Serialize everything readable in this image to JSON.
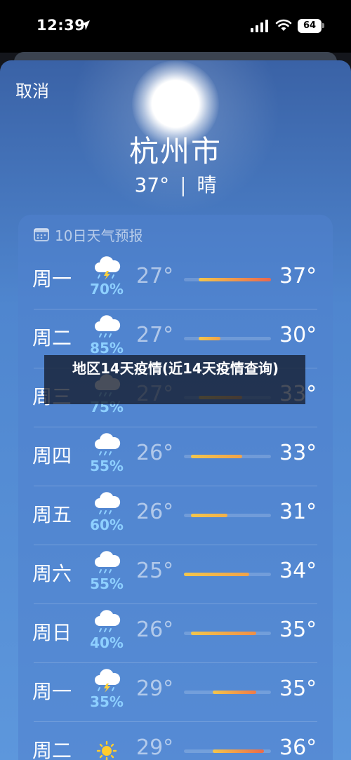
{
  "status_bar": {
    "time": "12:39",
    "battery": "64"
  },
  "header": {
    "cancel_label": "取消",
    "city": "杭州市",
    "current_temp": "37°",
    "current_condition": "晴"
  },
  "forecast": {
    "title": "10日天气预报",
    "temp_range": [
      25,
      37
    ],
    "days": [
      {
        "day": "周一",
        "icon": "thunderstorm-icon",
        "pop": "70%",
        "low": "27°",
        "high": "37°",
        "low_val": 27,
        "high_val": 37,
        "color": "#e9684e"
      },
      {
        "day": "周二",
        "icon": "rain-cloud-icon",
        "pop": "85%",
        "low": "27°",
        "high": "30°",
        "low_val": 27,
        "high_val": 30,
        "color": "#f0a24a"
      },
      {
        "day": "周三",
        "icon": "rain-cloud-icon",
        "pop": "75%",
        "low": "27°",
        "high": "33°",
        "low_val": 27,
        "high_val": 33,
        "color": "#f0a24a"
      },
      {
        "day": "周四",
        "icon": "rain-cloud-icon",
        "pop": "55%",
        "low": "26°",
        "high": "33°",
        "low_val": 26,
        "high_val": 33,
        "color": "#f0a24a"
      },
      {
        "day": "周五",
        "icon": "rain-cloud-icon",
        "pop": "60%",
        "low": "26°",
        "high": "31°",
        "low_val": 26,
        "high_val": 31,
        "color": "#f2b04a"
      },
      {
        "day": "周六",
        "icon": "rain-cloud-icon",
        "pop": "55%",
        "low": "25°",
        "high": "34°",
        "low_val": 25,
        "high_val": 34,
        "color": "#f0a24a"
      },
      {
        "day": "周日",
        "icon": "rain-cloud-icon",
        "pop": "40%",
        "low": "26°",
        "high": "35°",
        "low_val": 26,
        "high_val": 35,
        "color": "#ef8f48"
      },
      {
        "day": "周一",
        "icon": "thunderstorm-icon",
        "pop": "35%",
        "low": "29°",
        "high": "35°",
        "low_val": 29,
        "high_val": 35,
        "color": "#ef7a48"
      },
      {
        "day": "周二",
        "icon": "sun-icon",
        "pop": "",
        "low": "29°",
        "high": "36°",
        "low_val": 29,
        "high_val": 36,
        "color": "#eb6a4a"
      }
    ]
  },
  "banner": {
    "text": "地区14天疫情(近14天疫情查询)"
  }
}
